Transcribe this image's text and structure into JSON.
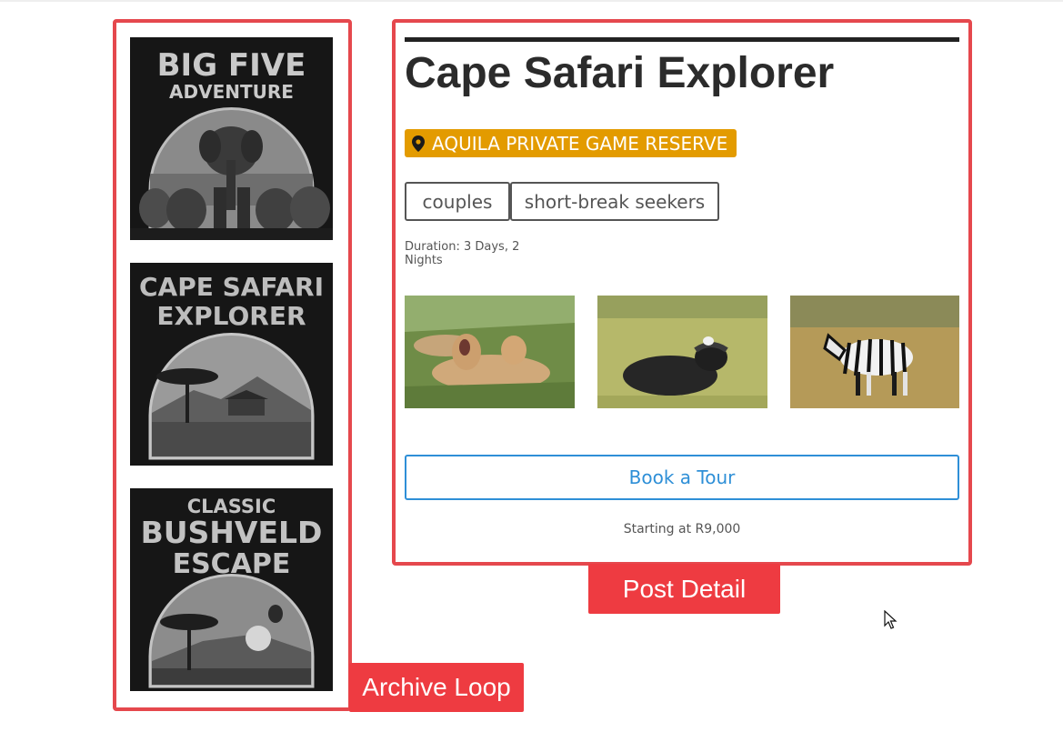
{
  "archive": {
    "label": "Archive Loop",
    "items": [
      {
        "title_lines": [
          "BIG FIVE",
          "ADVENTURE"
        ]
      },
      {
        "title_lines": [
          "CAPE SAFARI",
          "EXPLORER"
        ]
      },
      {
        "title_lines": [
          "CLASSIC",
          "BUSHVELD",
          "ESCAPE"
        ]
      }
    ]
  },
  "post": {
    "label": "Post Detail",
    "title": "Cape Safari Explorer",
    "location": "AQUILA PRIVATE GAME RESERVE",
    "audiences": [
      "couples",
      "short-break seekers"
    ],
    "duration": "Duration: 3 Days, 2 Nights",
    "cta_label": "Book a Tour",
    "price": "Starting at R9,000"
  },
  "icons": {
    "location": "map-pin-icon",
    "cursor": "mouse-pointer-icon"
  },
  "colors": {
    "frame": "#e5484d",
    "tag": "#ee3b41",
    "badge": "#e39b00",
    "button": "#2e8fd7",
    "title": "#2b2b2b"
  }
}
